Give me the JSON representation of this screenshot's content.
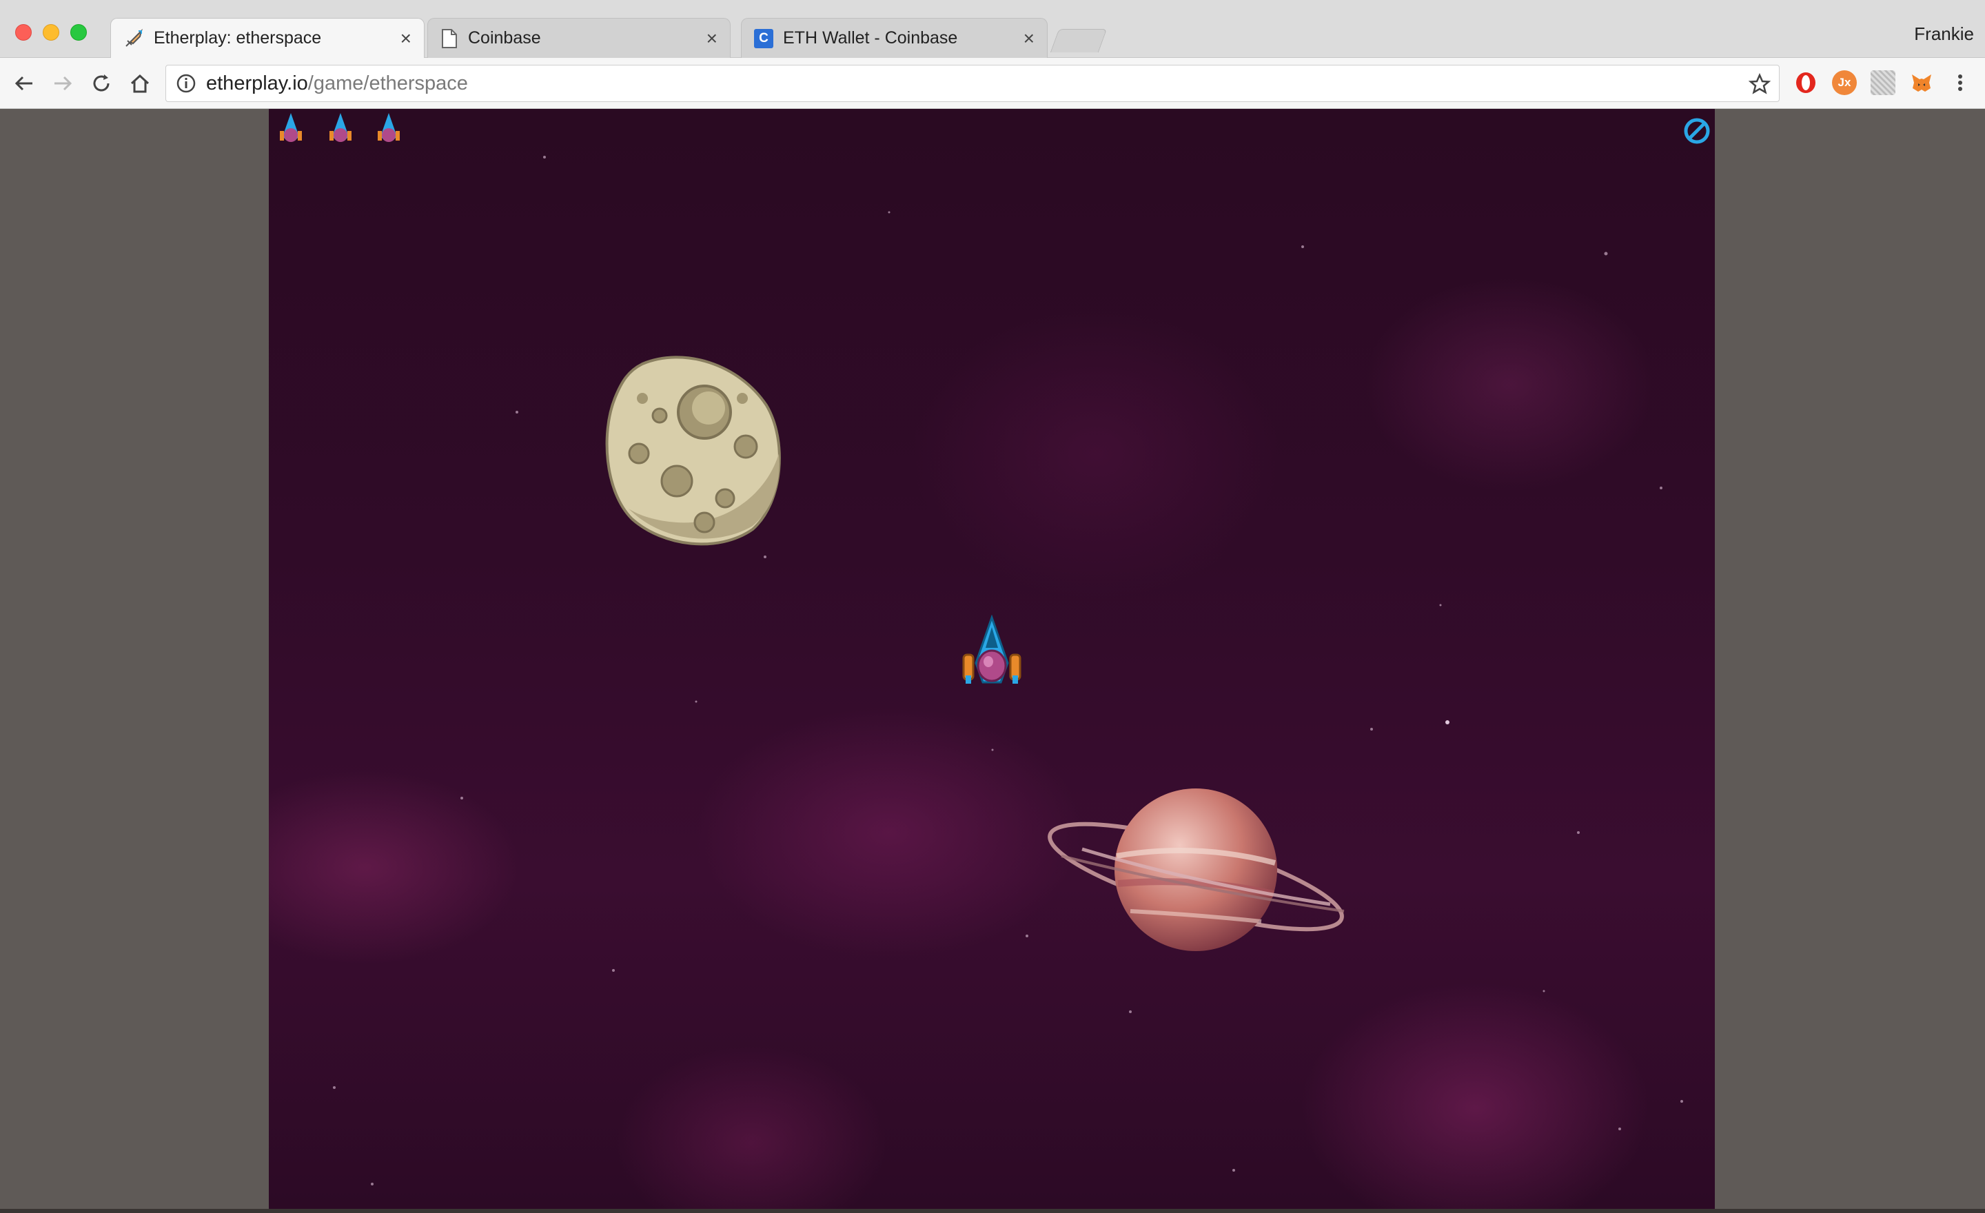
{
  "browser": {
    "tabs": [
      {
        "title": "Etherplay: etherspace",
        "active": true,
        "icon": "rocket-icon"
      },
      {
        "title": "Coinbase",
        "active": false,
        "icon": "document-icon"
      },
      {
        "title": "ETH Wallet - Coinbase",
        "active": false,
        "icon": "coinbase-icon",
        "icon_letter": "C"
      }
    ],
    "profile_name": "Frankie",
    "url": {
      "host": "etherplay.io",
      "path": "/game/etherspace"
    },
    "extensions": [
      "opera-icon",
      "jx-icon",
      "pattern-icon",
      "metamask-icon"
    ],
    "ext_jx_label": "Jx"
  },
  "game": {
    "title": "etherspace",
    "lives_remaining": 3,
    "mute_icon": "mute-icon",
    "objects": [
      "asteroid",
      "player-ship",
      "ringed-planet"
    ]
  },
  "colors": {
    "tab_active_bg": "#f6f6f6",
    "chrome_bg": "#dcdcdc",
    "space_bg": "#2c0a25",
    "ship_blue": "#2aa7e6",
    "ship_pink": "#b04a8a",
    "page_bg": "#5f5a57"
  }
}
